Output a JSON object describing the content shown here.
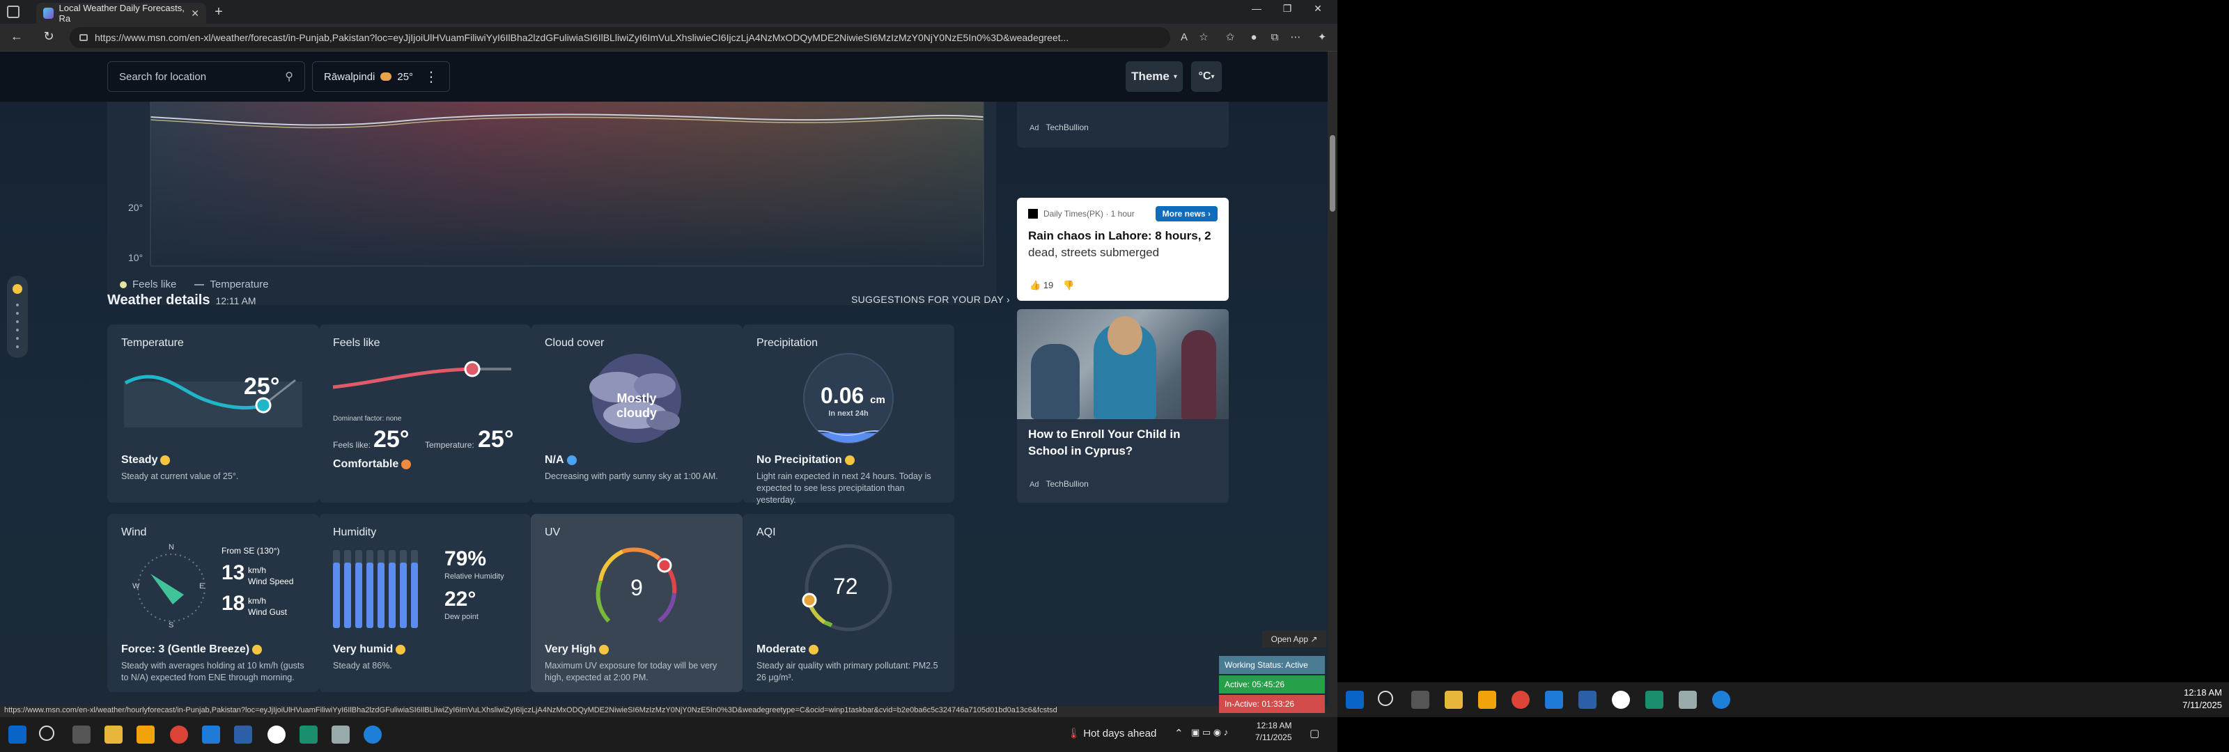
{
  "browser": {
    "tab_title": "Local Weather Daily Forecasts, Ra",
    "url": "https://www.msn.com/en-xl/weather/forecast/in-Punjab,Pakistan?loc=eyJjIjoiUlHVuamFiliwiYyI6IlBha2lzdGFuliwiaSI6IlBLliwiZyI6ImVuLXhsliwieCI6IjczLjA4NzMxODQyMDE2NiwieSI6MzIzMzY0NjY0NzE5In0%3D&weadegreet...",
    "status_url": "https://www.msn.com/en-xl/weather/hourlyforecast/in-Punjab,Pakistan?loc=eyJjIjoiUlHVuamFiliwiYyI6IlBha2lzdGFuliwiaSI6IlBLliwiZyI6ImVuLXhsliwiZyI6IjczLjA4NzMxODQyMDE2NiwieSI6MzIzMzY0NjY0NzE5In0%3D&weadegreetype=C&ocid=winp1taskbar&cvid=b2e0ba6c5c324746a7105d01bd0a13c6&fcstsd"
  },
  "weather_bar": {
    "search_placeholder": "Search for location",
    "location": "Rāwalpindi",
    "location_temp": "25°",
    "theme_label": "Theme",
    "unit_label": "°C"
  },
  "chart": {
    "ytick_20": "20°",
    "ytick_10": "10°",
    "legend_feels": "Feels like",
    "legend_temp": "Temperature"
  },
  "side": {
    "ad_label": "Ad",
    "ad_source_top": "TechBullion",
    "news_source": "Daily Times(PK) · 1 hour",
    "more_news": "More news",
    "headline": "Rain chaos in Lahore: 8 hours, 2",
    "headline2": "dead, streets submerged",
    "likes": "19",
    "article_title": "How to Enroll Your Child in School in Cyprus?",
    "ad_source_bottom": "TechBullion"
  },
  "details": {
    "title": "Weather details",
    "time": "12:11 AM",
    "suggestions": "SUGGESTIONS FOR YOUR DAY",
    "temperature": {
      "title": "Temperature",
      "value": "25°",
      "status": "Steady",
      "desc": "Steady at current value of 25°."
    },
    "feels": {
      "title": "Feels like",
      "dominant": "Dominant factor: none",
      "feels_label": "Feels like:",
      "feels_value": "25°",
      "temp_label": "Temperature:",
      "temp_value": "25°",
      "status": "Comfortable"
    },
    "cloud": {
      "title": "Cloud cover",
      "center": "Mostly cloudy",
      "status": "N/A",
      "desc": "Decreasing with partly sunny sky at 1:00 AM."
    },
    "precip": {
      "title": "Precipitation",
      "value": "0.06",
      "unit": "cm",
      "sub": "In next 24h",
      "status": "No Precipitation",
      "desc": "Light rain expected in next 24 hours. Today is expected to see less precipitation than yesterday."
    },
    "wind": {
      "title": "Wind",
      "from": "From SE (130°)",
      "n": "N",
      "e": "E",
      "s": "S",
      "w": "W",
      "speed": "13",
      "speed_unit": "km/h",
      "speed_label": "Wind Speed",
      "gust": "18",
      "gust_unit": "km/h",
      "gust_label": "Wind Gust",
      "status": "Force: 3 (Gentle Breeze)",
      "desc": "Steady with averages holding at 10 km/h (gusts to N/A) expected from ENE through morning."
    },
    "humidity": {
      "title": "Humidity",
      "value": "79%",
      "label": "Relative Humidity",
      "dew": "22°",
      "dew_label": "Dew point",
      "status": "Very humid",
      "desc": "Steady at 86%."
    },
    "uv": {
      "title": "UV",
      "value": "9",
      "status": "Very High",
      "desc": "Maximum UV exposure for today will be very high, expected at 2:00 PM."
    },
    "aqi": {
      "title": "AQI",
      "value": "72",
      "status": "Moderate",
      "desc": "Steady air quality with primary pollutant: PM2.5 26 μg/m³."
    }
  },
  "widget": {
    "open_app": "Open App ↗",
    "working": "Working Status: Active",
    "active": "Active: 05:45:26",
    "inactive": "In-Active: 01:33:26"
  },
  "taskbar1": {
    "weather_text": "Hot days ahead",
    "time": "12:18 AM",
    "date": "7/11/2025"
  },
  "taskbar2": {
    "time": "12:18 AM",
    "date": "7/11/2025"
  },
  "colors": {
    "accent": "#0f6cbd",
    "temp_line": "#1fb6c9",
    "feels_line": "#e05a6a",
    "humidity_bar": "#5b8cf0"
  }
}
